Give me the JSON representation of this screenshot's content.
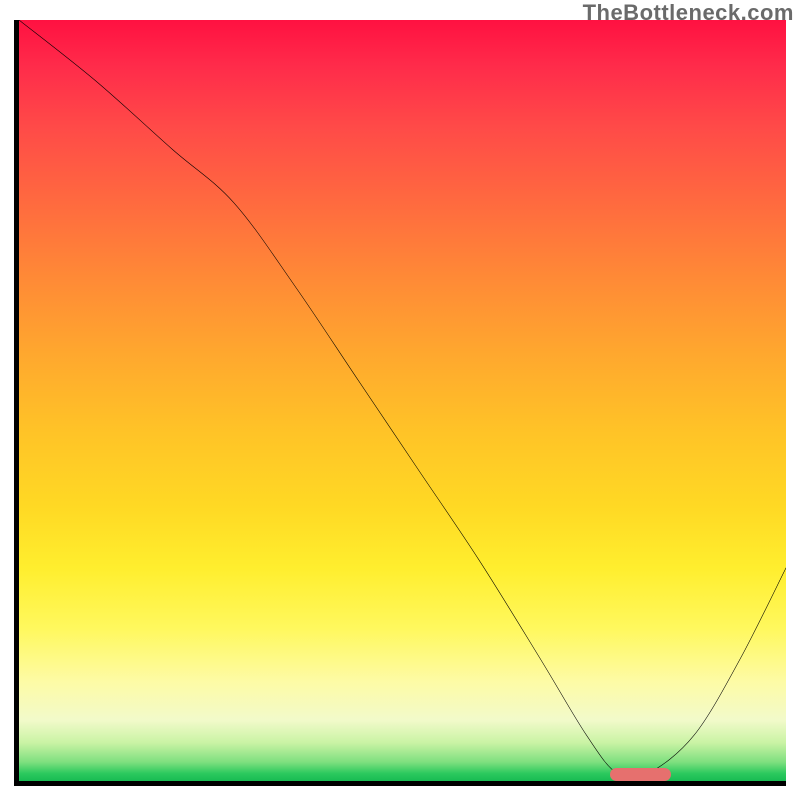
{
  "watermark_text": "TheBottleneck.com",
  "colors": {
    "gradient_top": "#ff1141",
    "gradient_mid_up": "#ff8a36",
    "gradient_mid": "#ffee2e",
    "gradient_low": "#fdfba6",
    "gradient_bottom": "#18bb53",
    "curve": "#000000",
    "marker": "#e6706e",
    "axis": "#000000"
  },
  "chart_data": {
    "type": "line",
    "title": "",
    "xlabel": "",
    "ylabel": "",
    "xlim": [
      0,
      100
    ],
    "ylim": [
      0,
      100
    ],
    "series": [
      {
        "name": "bottleneck-curve",
        "x": [
          0,
          10,
          20,
          28,
          36,
          44,
          52,
          60,
          68,
          74,
          78,
          82,
          88,
          94,
          100
        ],
        "values": [
          100,
          92,
          83,
          76,
          65,
          53,
          41,
          29,
          16,
          6,
          1,
          1,
          6,
          16,
          28
        ]
      }
    ],
    "marker": {
      "name": "highlight-range",
      "x_start": 77,
      "x_end": 85,
      "y": 0.5
    },
    "background_scale": {
      "description": "vertical red-to-green gradient indicating severity (red=high, green=low)"
    }
  }
}
